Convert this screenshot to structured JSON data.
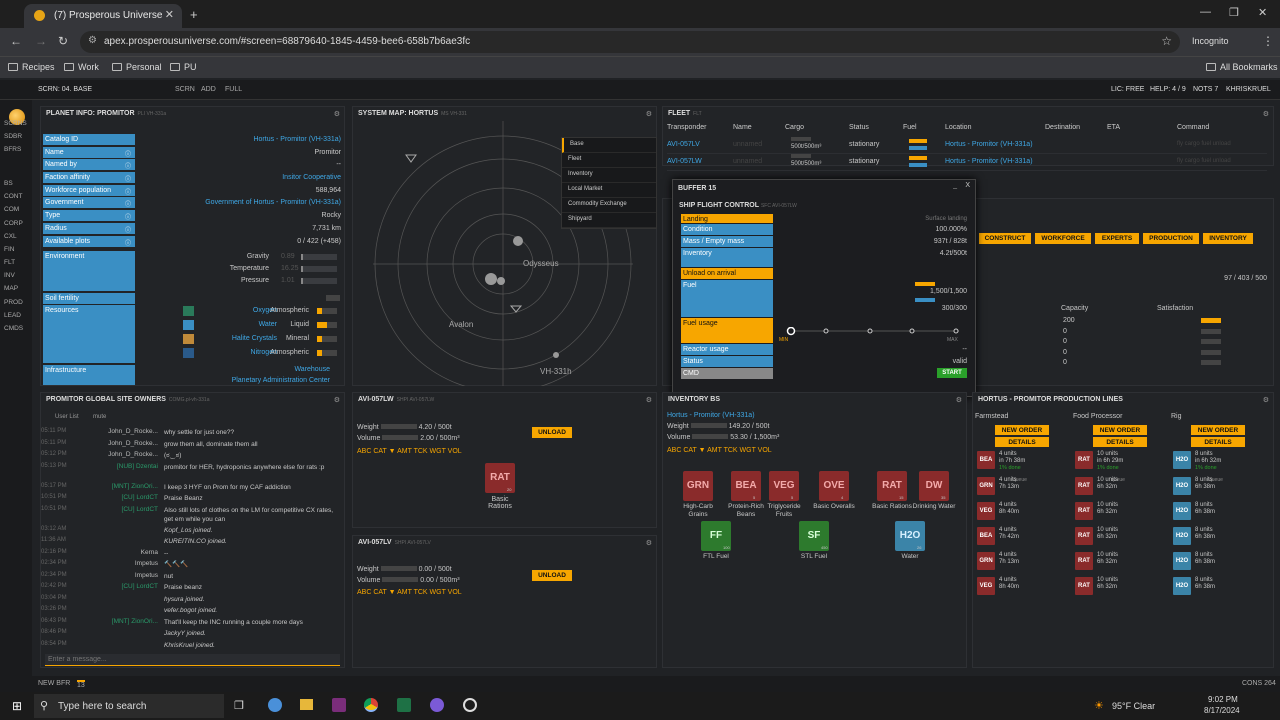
{
  "browser": {
    "tab_title": "(7) Prosperous Universe",
    "url": "apex.prosperousuniverse.com/#screen=68879640-1845-4459-bee6-658b7b6ae3fc",
    "profile": "Incognito",
    "bookmarks": [
      "Recipes",
      "Work",
      "Personal",
      "PU"
    ],
    "all_bookmarks": "All Bookmarks"
  },
  "topbar": {
    "screen": "SCRN: 04. BASE",
    "scrn": "SCRN",
    "add": "ADD",
    "full": "FULL",
    "lic": "LIC: FREE",
    "help": "HELP: 4 / 9",
    "notifs": "NOTS 7",
    "user": "KHRISKRUEL"
  },
  "leftnav": [
    "SCRNS",
    "SDBR",
    "BFRS",
    "BS",
    "CONT",
    "COM",
    "CORP",
    "CXL",
    "FIN",
    "FLT",
    "INV",
    "MAP",
    "PROD",
    "LEAD",
    "CMDS"
  ],
  "planet": {
    "title": "PLANET INFO: PROMITOR",
    "title_small": "PLI VH-331a",
    "rows": [
      [
        "Catalog ID",
        "Hortus - Promitor (VH-331a)"
      ],
      [
        "Name",
        "Promitor"
      ],
      [
        "Named by",
        "--"
      ],
      [
        "Faction affinity",
        "Insitor Cooperative"
      ],
      [
        "Workforce population",
        "588,964"
      ],
      [
        "Government",
        "Government of Hortus - Promitor (VH-331a)"
      ],
      [
        "Type",
        "Rocky"
      ],
      [
        "Radius",
        "7,731 km"
      ],
      [
        "Available plots",
        "0 / 422 (+458)"
      ]
    ],
    "env_label": "Environment",
    "env": [
      [
        "Gravity",
        "0.89"
      ],
      [
        "Temperature",
        "16.25"
      ],
      [
        "Pressure",
        "1.01"
      ]
    ],
    "soil": "Soil fertility",
    "res_label": "Resources",
    "resources": [
      [
        "Oxygen",
        "Atmospheric"
      ],
      [
        "Water",
        "Liquid"
      ],
      [
        "Halite Crystals",
        "Mineral"
      ],
      [
        "Nitrogen",
        "Atmospheric"
      ]
    ],
    "infra_label": "Infrastructure",
    "infra": [
      "Warehouse",
      "Planetary Administration Center"
    ]
  },
  "sysmap": {
    "title": "SYSTEM MAP: HORTUS",
    "title_small": "MS VH-331",
    "menu": [
      "Base",
      "Fleet",
      "Inventory",
      "Local Market",
      "Commodity Exchange",
      "Shipyard"
    ],
    "labels": [
      "Odysseus",
      "Avalon",
      "VH-331h"
    ]
  },
  "fleet": {
    "title": "FLEET",
    "title_small": "FLT",
    "cols": [
      "Transponder",
      "Name",
      "Cargo",
      "Status",
      "Fuel",
      "Location",
      "Destination",
      "ETA",
      "Command"
    ],
    "rows": [
      [
        "AVI-057LV",
        "unnamed",
        "500t/500m³",
        "stationary",
        "Hortus - Promitor (VH-331a)"
      ],
      [
        "AVI-057LW",
        "unnamed",
        "500t/500m³",
        "stationary",
        "Hortus - Promitor (VH-331a)"
      ]
    ],
    "cmds": "fly  cargo  fuel  unload"
  },
  "base": {
    "buttons": [
      "CONSTRUCT",
      "WORKFORCE",
      "EXPERTS",
      "PRODUCTION",
      "INVENTORY"
    ],
    "area": "97 / 403 / 500",
    "cols": [
      "Capacity",
      "Satisfaction"
    ],
    "capacity": [
      "200",
      "0",
      "0",
      "0",
      "0"
    ]
  },
  "buffer": {
    "title": "BUFFER 15",
    "sfc_title": "SHIP FLIGHT CONTROL",
    "sfc_small": "SFC AVI-057LW",
    "rows": [
      [
        "Landing",
        "Surface landing"
      ],
      [
        "Condition",
        "100.000%"
      ],
      [
        "Mass / Empty mass",
        "937t / 828t"
      ],
      [
        "Inventory",
        "4.2t/500t"
      ],
      [
        "Unload on arrival",
        ""
      ],
      [
        "Fuel",
        "1,500/1,500"
      ],
      [
        "",
        "300/300"
      ],
      [
        "Fuel usage",
        ""
      ],
      [
        "Reactor usage",
        "--"
      ],
      [
        "Status",
        "valid"
      ],
      [
        "CMD",
        "START"
      ]
    ],
    "min": "MIN",
    "max": "MAX"
  },
  "chat": {
    "title": "PROMITOR GLOBAL SITE OWNERS",
    "title_small": "COMG.pl-vh-331a",
    "tabs": [
      "User List",
      "mute"
    ],
    "placeholder": "Enter a message...",
    "lines": [
      [
        "05:11 PM",
        "John_D_Rocke...",
        "why settle for just one??"
      ],
      [
        "05:11 PM",
        "John_D_Rocke...",
        "grow them all, dominate them all"
      ],
      [
        "05:12 PM",
        "John_D_Rocke...",
        "(ಠ‿ಠ)"
      ],
      [
        "05:13 PM",
        "[NUB] Dzentai",
        "promitor for HER, hydroponics anywhere else for rats :p"
      ],
      [
        "05:17 PM",
        "[MNT] ZionOri...",
        "I keep 3 HYF on Prom for my CAF addiction"
      ],
      [
        "10:51 PM",
        "[CU] LordCT",
        "Praise Beanz"
      ],
      [
        "10:51 PM",
        "[CU] LordCT",
        "Also still lots of clothes on the LM for competitive CX rates, get em while you can"
      ],
      [
        "03:12 AM",
        "",
        "Kopf_Los joined."
      ],
      [
        "11:36 AM",
        "",
        "KUREITIN.CO joined."
      ],
      [
        "02:16 PM",
        "Kerna",
        "--"
      ],
      [
        "02:34 PM",
        "Impetus",
        "🔨🔨🔨"
      ],
      [
        "02:34 PM",
        "Impetus",
        "nut"
      ],
      [
        "02:42 PM",
        "[CU] LordCT",
        "Praise beanz"
      ],
      [
        "03:04 PM",
        "",
        "hysura joined."
      ],
      [
        "03:26 PM",
        "",
        "vefer.bogot joined."
      ],
      [
        "06:43 PM",
        "[MNT] ZionOri...",
        "That'll keep the INC running a couple more days"
      ],
      [
        "08:46 PM",
        "",
        "JackyY joined."
      ],
      [
        "08:54 PM",
        "",
        "KhrisKruel joined."
      ]
    ]
  },
  "ship1": {
    "title": "AVI-057LW",
    "title_small": "SHPI AVI-057LW",
    "weight": "4.20 / 500t",
    "volume": "2.00 / 500m³",
    "unload": "UNLOAD",
    "sort": "ABC CAT ▼ AMT TCK WGT VOL",
    "items": [
      [
        "RAT",
        "20",
        "Basic Rations"
      ]
    ]
  },
  "ship2": {
    "title": "AVI-057LV",
    "title_small": "SHPI AVI-057LV",
    "weight": "0.00 / 500t",
    "volume": "0.00 / 500m³",
    "unload": "UNLOAD",
    "sort": "ABC CAT ▼ AMT TCK WGT VOL"
  },
  "inv": {
    "title": "INVENTORY BS",
    "location": "Hortus - Promitor (VH-331a)",
    "weight": "149.20 / 500t",
    "volume": "53.30 / 1,500m³",
    "sort": "ABC CAT ▼ AMT TCK WGT VOL",
    "items": [
      [
        "GRN",
        "",
        "High-Carb Grains",
        "red"
      ],
      [
        "BEA",
        "5",
        "Protein-Rich Beans",
        "red"
      ],
      [
        "VEG",
        "5",
        "Triglyceride Fruits",
        "red"
      ],
      [
        "OVE",
        "4",
        "Basic Overalls",
        "red"
      ],
      [
        "RAT",
        "15",
        "Basic Rations",
        "red"
      ],
      [
        "DW",
        "35",
        "Drinking Water",
        "red"
      ],
      [
        "FF",
        "100",
        "FTL Fuel",
        "green"
      ],
      [
        "SF",
        "450",
        "STL Fuel",
        "green"
      ],
      [
        "H2O",
        "26",
        "Water",
        "blue"
      ]
    ]
  },
  "prodlines": {
    "title": "HORTUS - PROMITOR PRODUCTION LINES",
    "lines": [
      "Farmstead",
      "Food Processor",
      "Rig"
    ],
    "new_order": "NEW ORDER",
    "details": "DETAILS",
    "queue": "queue",
    "farm": [
      [
        "BEA",
        "4 units",
        "in 7h 38m",
        "1% done"
      ],
      [
        "GRN",
        "4 units",
        "7h 13m"
      ],
      [
        "VEG",
        "4 units",
        "8h 40m"
      ],
      [
        "BEA",
        "4 units",
        "7h 42m"
      ],
      [
        "GRN",
        "4 units",
        "7h 13m"
      ],
      [
        "VEG",
        "4 units",
        "8h 40m"
      ]
    ],
    "food": [
      [
        "RAT",
        "10 units",
        "in 6h 29m",
        "1% done"
      ],
      [
        "RAT",
        "10 units",
        "6h 32m"
      ],
      [
        "RAT",
        "10 units",
        "6h 32m"
      ],
      [
        "RAT",
        "10 units",
        "6h 32m"
      ],
      [
        "RAT",
        "10 units",
        "6h 32m"
      ],
      [
        "RAT",
        "10 units",
        "6h 32m"
      ]
    ],
    "rig": [
      [
        "H2O",
        "8 units",
        "in 6h 32m",
        "1% done"
      ],
      [
        "H2O",
        "8 units",
        "6h 38m"
      ],
      [
        "H2O",
        "8 units",
        "6h 38m"
      ],
      [
        "H2O",
        "8 units",
        "6h 38m"
      ],
      [
        "H2O",
        "8 units",
        "6h 38m"
      ],
      [
        "H2O",
        "8 units",
        "6h 38m"
      ]
    ]
  },
  "footer": {
    "new_bfr": "NEW BFR",
    "count": "13",
    "cons": "CONS 264"
  },
  "taskbar": {
    "search": "Type here to search",
    "weather": "95°F Clear",
    "time": "9:02 PM",
    "date": "8/17/2024"
  }
}
